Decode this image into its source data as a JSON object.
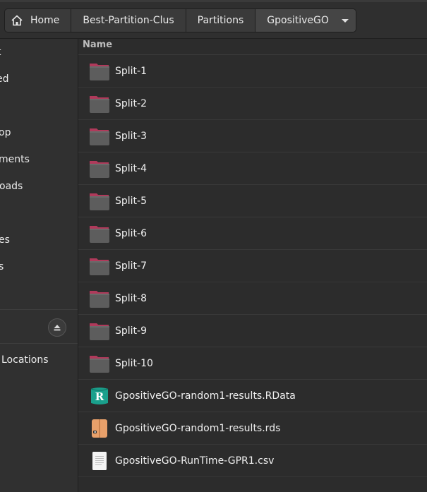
{
  "breadcrumb": {
    "items": [
      "Home",
      "Best-Partition-Clus",
      "Partitions",
      "GpositiveGO"
    ]
  },
  "sidebar": {
    "items": [
      {
        "label": "t"
      },
      {
        "label": "ed"
      },
      {
        "label": "op"
      },
      {
        "label": "ments"
      },
      {
        "label": "oads"
      },
      {
        "label": "es"
      },
      {
        "label": "s"
      },
      {
        "label": "Locations"
      }
    ]
  },
  "list": {
    "column_name": "Name",
    "items": [
      {
        "name": "Split-1",
        "type": "folder"
      },
      {
        "name": "Split-2",
        "type": "folder"
      },
      {
        "name": "Split-3",
        "type": "folder"
      },
      {
        "name": "Split-4",
        "type": "folder"
      },
      {
        "name": "Split-5",
        "type": "folder"
      },
      {
        "name": "Split-6",
        "type": "folder"
      },
      {
        "name": "Split-7",
        "type": "folder"
      },
      {
        "name": "Split-8",
        "type": "folder"
      },
      {
        "name": "Split-9",
        "type": "folder"
      },
      {
        "name": "Split-10",
        "type": "folder"
      },
      {
        "name": "GpositiveGO-random1-results.RData",
        "type": "r-data"
      },
      {
        "name": "GpositiveGO-random1-results.rds",
        "type": "archive"
      },
      {
        "name": "GpositiveGO-RunTime-GPR1.csv",
        "type": "text"
      }
    ]
  },
  "colors": {
    "folder_tab": "#b03a5b",
    "folder_body": "#5d5d5d",
    "r_icon": "#1aa08c",
    "archive_icon": "#e8a06a"
  }
}
